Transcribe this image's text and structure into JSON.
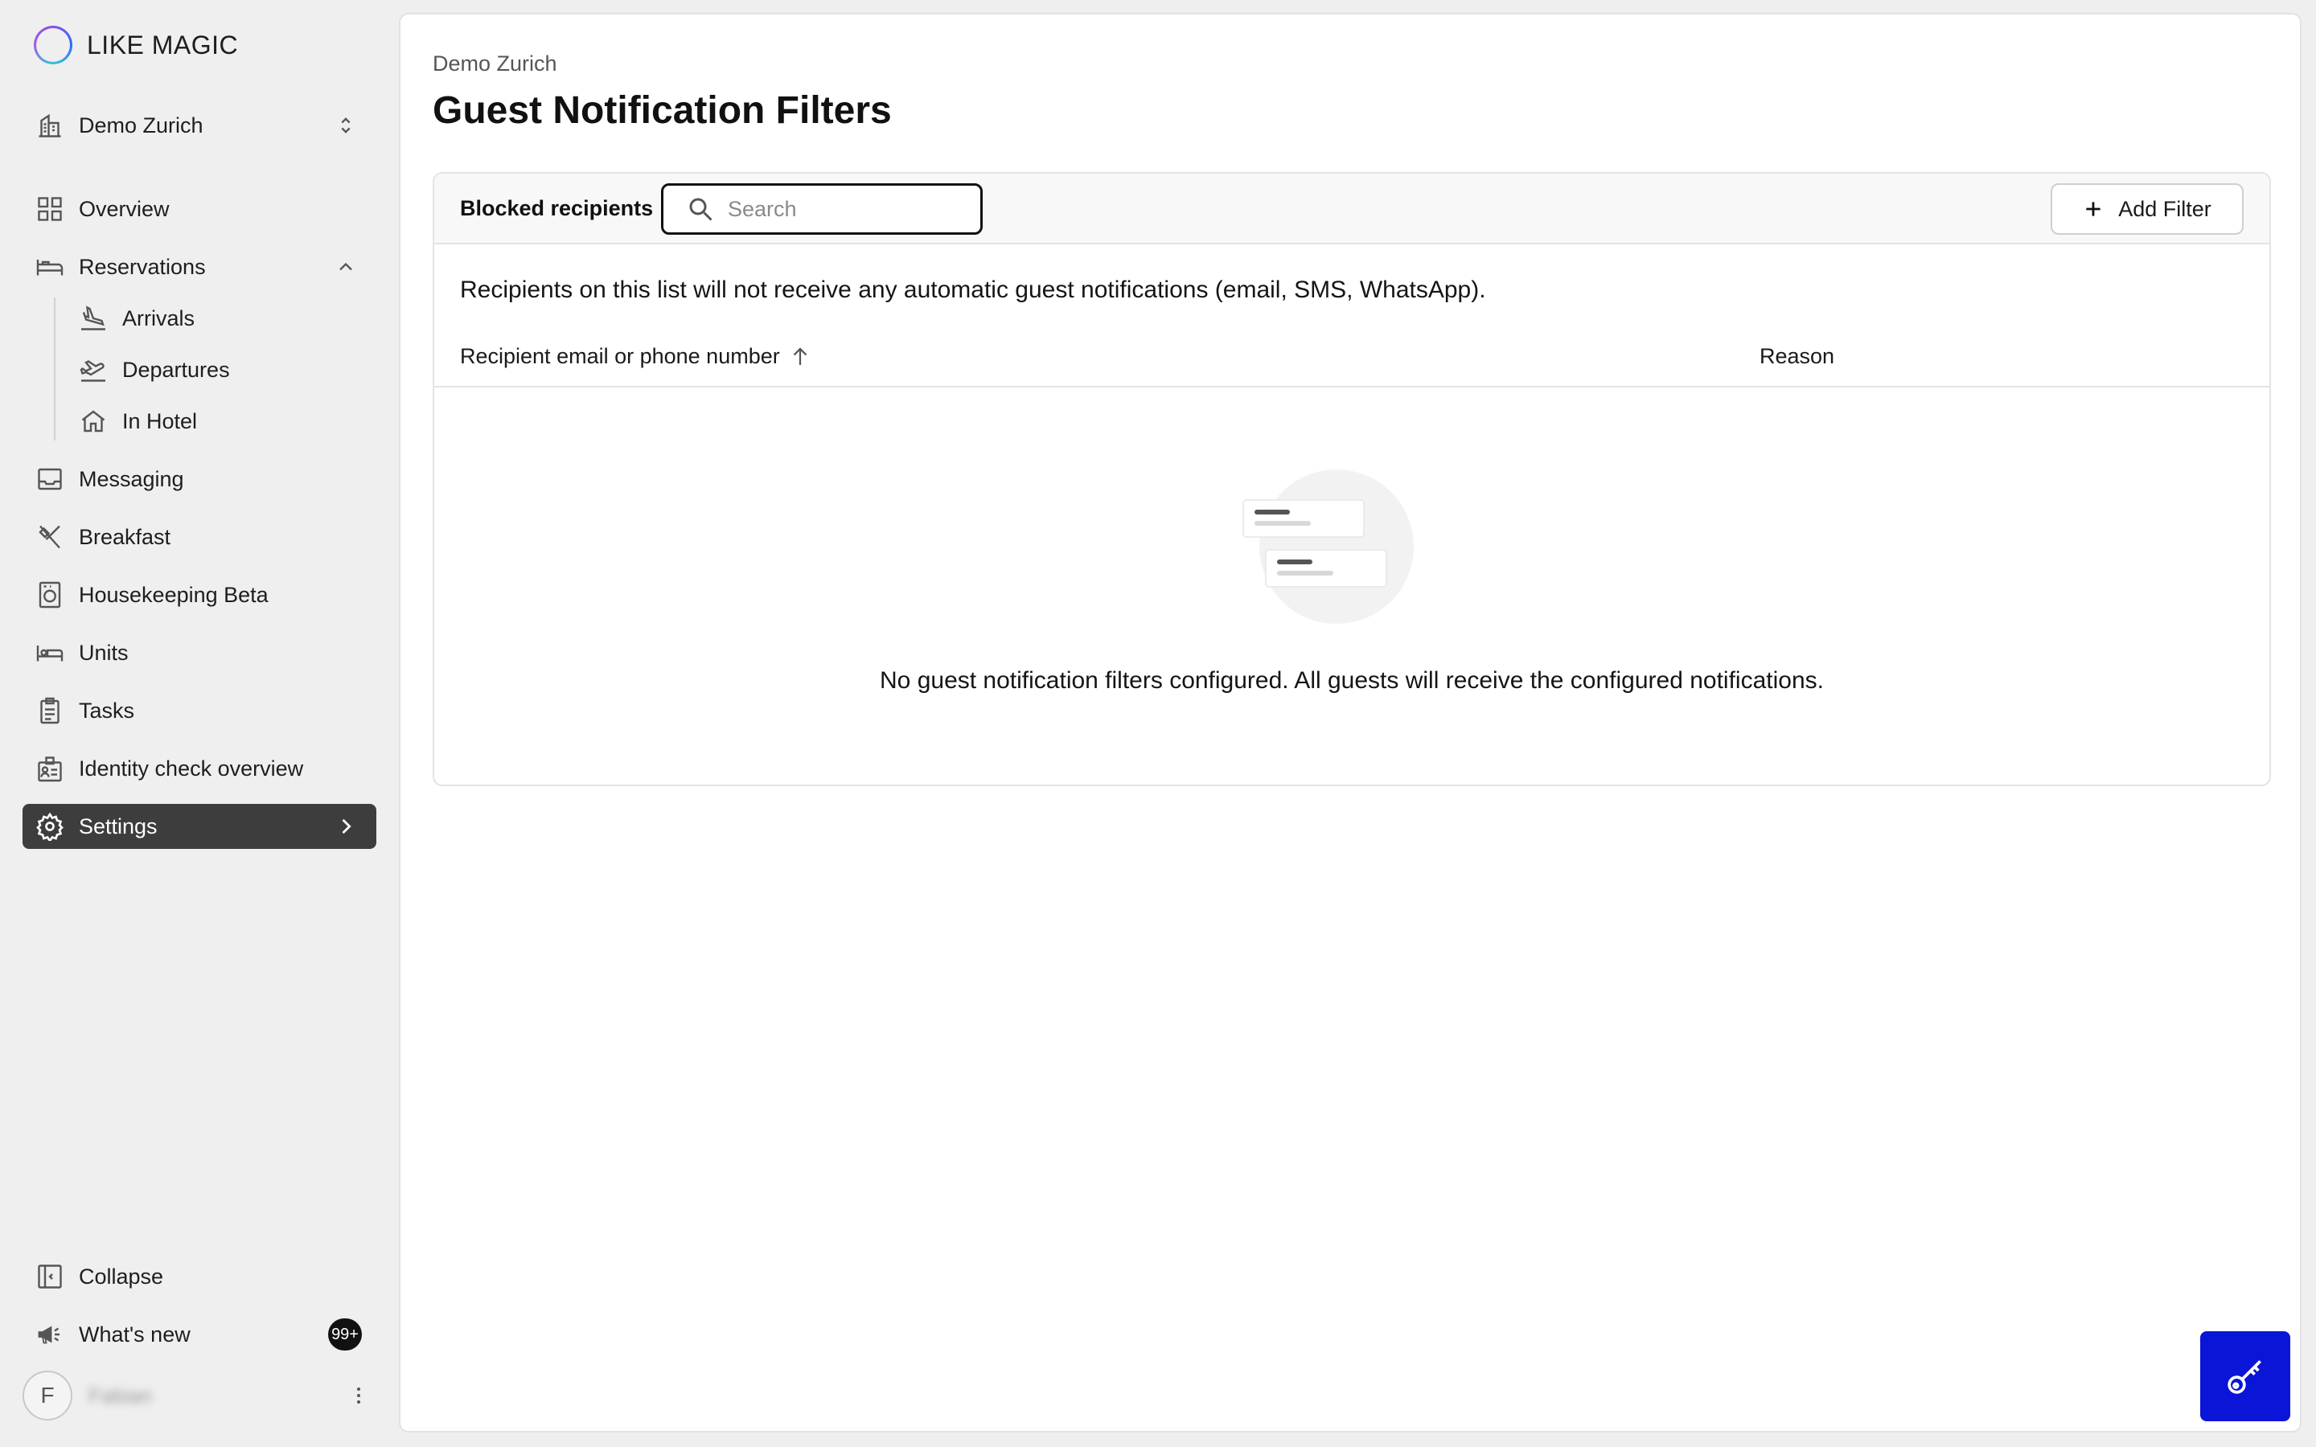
{
  "app": {
    "logo_text": "LIKE MAGIC"
  },
  "sidebar": {
    "property": {
      "label": "Demo Zurich"
    },
    "items": [
      {
        "label": "Overview",
        "icon": "grid-icon"
      },
      {
        "label": "Reservations",
        "icon": "bed-icon"
      },
      {
        "label": "Arrivals",
        "icon": "plane-landing-icon"
      },
      {
        "label": "Departures",
        "icon": "plane-takeoff-icon"
      },
      {
        "label": "In Hotel",
        "icon": "home-icon"
      },
      {
        "label": "Messaging",
        "icon": "inbox-icon"
      },
      {
        "label": "Breakfast",
        "icon": "utensils-icon"
      },
      {
        "label": "Housekeeping Beta",
        "icon": "washing-machine-icon"
      },
      {
        "label": "Units",
        "icon": "bed-unit-icon"
      },
      {
        "label": "Tasks",
        "icon": "clipboard-icon"
      },
      {
        "label": "Identity check overview",
        "icon": "id-card-icon"
      },
      {
        "label": "Settings",
        "icon": "gear-icon"
      }
    ],
    "collapse_label": "Collapse",
    "whats_new_label": "What's new",
    "whats_new_badge": "99+",
    "user": {
      "initial": "F",
      "name": "Fabian"
    }
  },
  "main": {
    "breadcrumb": "Demo Zurich",
    "title": "Guest Notification Filters",
    "card": {
      "header_label": "Blocked recipients",
      "search_placeholder": "Search",
      "search_value": "",
      "add_button_label": "Add Filter",
      "description": "Recipients on this list will not receive any automatic guest notifications (email, SMS, WhatsApp).",
      "columns": [
        "Recipient email or phone number",
        "Reason"
      ],
      "empty_message": "No guest notification filters configured. All guests will receive the configured notifications."
    }
  },
  "colors": {
    "active_nav_bg": "#3d3d3d",
    "fab_bg": "#0a15d8",
    "page_bg": "#efefef"
  }
}
